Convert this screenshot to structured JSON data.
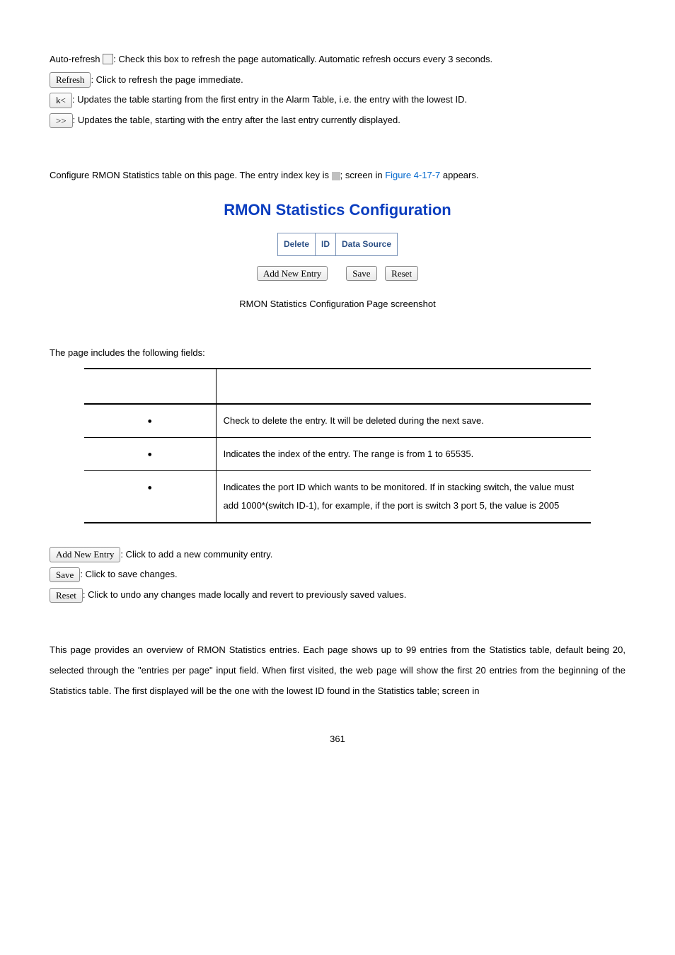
{
  "top": {
    "autoRefreshLabel": "Auto-refresh",
    "autoRefreshDesc": ": Check this box to refresh the page automatically. Automatic refresh occurs every 3 seconds.",
    "refreshBtn": "Refresh",
    "refreshDesc": ": Click to refresh the page immediate.",
    "firstBtn": "k<",
    "firstDesc": ": Updates the table starting from the first entry in the Alarm Table, i.e. the entry with the lowest ID.",
    "nextBtn": ">>",
    "nextDesc": ": Updates the table, starting with the entry after the last entry currently displayed."
  },
  "intro": {
    "part1": "Configure RMON Statistics table on this page. The entry index key is ",
    "part2": "; screen in ",
    "figLink": "Figure 4-17-7",
    "part3": " appears."
  },
  "configHeading": "RMON Statistics Configuration",
  "headers": {
    "delete": "Delete",
    "id": "ID",
    "dataSource": "Data Source"
  },
  "buttons": {
    "addNewEntry": "Add New Entry",
    "save": "Save",
    "reset": "Reset"
  },
  "caption": "RMON Statistics Configuration Page screenshot",
  "fieldsIntro": "The page includes the following fields:",
  "fields": [
    {
      "desc": "Check to delete the entry. It will be deleted during the next save."
    },
    {
      "desc": "Indicates the index of the entry. The range is from 1 to 65535."
    },
    {
      "desc": "Indicates the port ID which wants to be monitored. If in stacking switch, the value must add 1000*(switch ID-1), for example, if the port is switch 3 port 5, the value is 2005"
    }
  ],
  "bottom": {
    "addNewEntryDesc": ": Click to add a new community entry.",
    "saveDesc": ": Click to save changes.",
    "resetDesc": ": Click to undo any changes made locally and revert to previously saved values."
  },
  "overview": "This page provides an overview of RMON Statistics entries. Each page shows up to 99 entries from the Statistics table, default being 20, selected through the \"entries per page\" input field. When first visited, the web page will show the first 20 entries from the beginning of the Statistics table. The first displayed will be the one with the lowest ID found in the Statistics table; screen in",
  "pageNumber": "361"
}
